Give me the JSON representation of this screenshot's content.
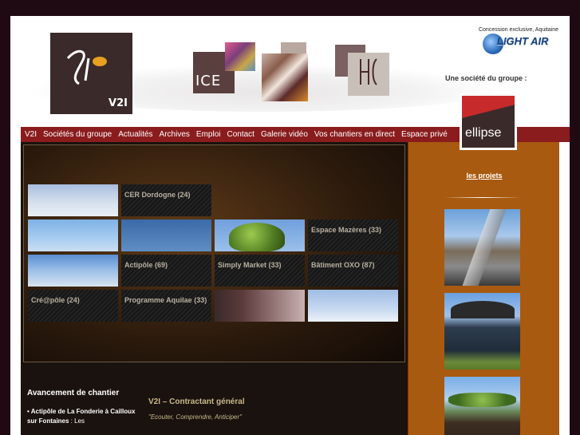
{
  "header": {
    "concession_text": "Concession exclusive, Aquitaine",
    "lightair_name": "LIGHT AIR",
    "groupe_text": "Une société du groupe :",
    "v2i_logo_text": "V2I",
    "ice_logo_text": "ICE",
    "ellipse_logo_text": "ellipse"
  },
  "nav": {
    "items": [
      "V2I",
      "Sociétés du groupe",
      "Actualités",
      "Archives",
      "Emploi",
      "Contact",
      "Galerie vidéo",
      "Vos chantiers en direct",
      "Espace privé"
    ]
  },
  "gallery": {
    "tiles": [
      "CER Dordogne (24)",
      "Espace Mazères (33)",
      "Actipôle (69)",
      "Simply Market (33)",
      "Bâtiment OXO (87)",
      "Cré@pôle (24)",
      "Programme Aquilae (33)"
    ]
  },
  "avancement": {
    "title": "Avancement de chantier",
    "item_title": "• Actipôle de La Fonderie à Cailloux sur Fontaines",
    "item_text": " : Les"
  },
  "contractant": {
    "title": "V2I – Contractant général",
    "quote": "\"Ecouter, Comprendre, Anticiper\""
  },
  "sidebar": {
    "projects_link": "les projets"
  },
  "colors": {
    "nav_bg": "#8a1c1e",
    "sidebar_bg": "#a85a10",
    "main_bg": "#1a120e",
    "accent_text": "#c9b98a"
  }
}
